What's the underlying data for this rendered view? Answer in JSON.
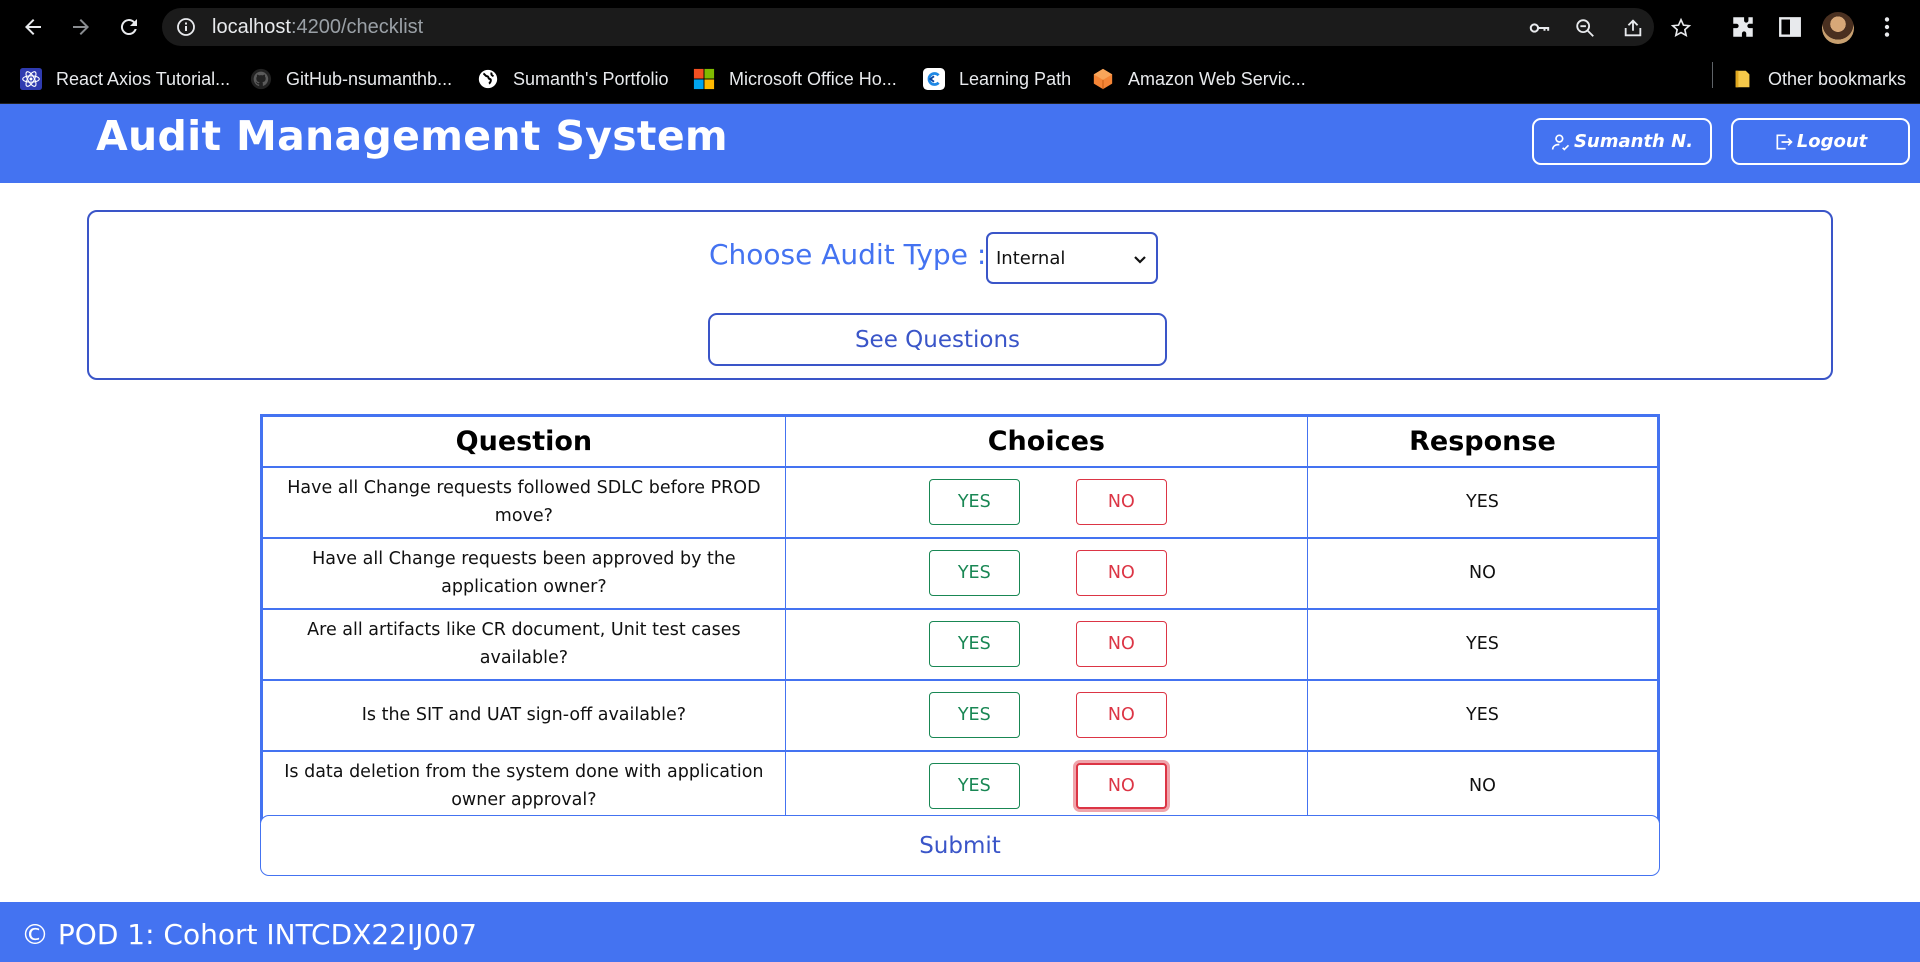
{
  "browser": {
    "url_host": "localhost",
    "url_path": ":4200/checklist",
    "bookmarks": [
      {
        "label": "React Axios Tutorial...",
        "icon": "react-icon"
      },
      {
        "label": "GitHub-nsumanthb...",
        "icon": "github-icon"
      },
      {
        "label": "Sumanth's Portfolio",
        "icon": "globe-icon"
      },
      {
        "label": "Microsoft Office Ho...",
        "icon": "microsoft-icon"
      },
      {
        "label": "Learning Path",
        "icon": "learning-path-icon"
      },
      {
        "label": "Amazon Web Servic...",
        "icon": "aws-icon"
      }
    ],
    "other_bookmarks": "Other bookmarks"
  },
  "header": {
    "title": "Audit Management System",
    "user_label": "Sumanth N.",
    "logout_label": "Logout"
  },
  "audit": {
    "label": "Choose Audit Type :",
    "selected": "Internal",
    "see_questions_label": "See Questions"
  },
  "table": {
    "headers": [
      "Question",
      "Choices",
      "Response"
    ],
    "yes_label": "YES",
    "no_label": "NO",
    "rows": [
      {
        "question": "Have all Change requests followed SDLC before PROD move?",
        "response": "YES"
      },
      {
        "question": "Have all Change requests been approved by the application owner?",
        "response": "NO"
      },
      {
        "question": "Are all artifacts like CR document, Unit test cases available?",
        "response": "YES"
      },
      {
        "question": "Is the SIT and UAT sign-off available?",
        "response": "YES"
      },
      {
        "question": "Is data deletion from the system done with application owner approval?",
        "response": "NO"
      }
    ]
  },
  "submit_label": "Submit",
  "footer": {
    "text": "© POD 1: Cohort INTCDX22IJ007"
  },
  "colors": {
    "brand_blue": "#4473f1",
    "border_blue": "#3a55c8",
    "yes_green": "#198754",
    "no_red": "#dc3545"
  }
}
